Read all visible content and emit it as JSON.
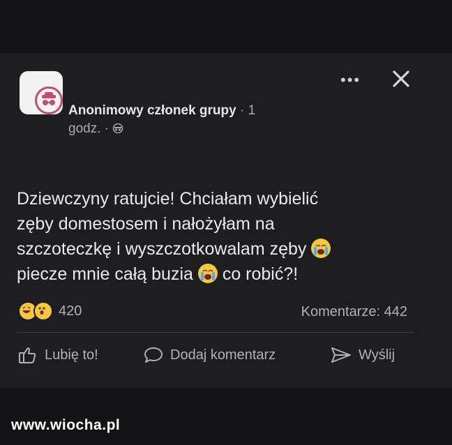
{
  "post": {
    "author": "Anonimowy członek grupy",
    "time_part1": "· 1",
    "time_part2": "godz. ·",
    "text_line1": "Dziewczyny ratujcie! Chciałam wybielić",
    "text_line2": "zęby domestosem i nałożyłam na",
    "text_line3": "szczoteczkę i wyszczotkowalam zęby",
    "text_line4a": "piecze mnie całą buzia",
    "text_line4b": "co robić?!",
    "reactions_count": "420",
    "comments": "Komentarze: 442"
  },
  "icons": {
    "more": "ellipsis-icon",
    "close": "close-icon",
    "privacy": "anonymous-icon",
    "crying_emoji": "loudly-crying-face-emoji",
    "reaction_1": "haha-emoji",
    "reaction_2": "wow-emoji"
  },
  "actions": {
    "like": "Lubię to!",
    "comment": "Dodaj komentarz",
    "share": "Wyślij"
  },
  "watermark": "www.wiocha.pl",
  "colors": {
    "background": "#141416",
    "card": "#1e1e20",
    "text": "#e4e6eb",
    "muted": "#b0b3b8",
    "emoji": "#f6c744",
    "badge_border": "#c04e6c"
  }
}
